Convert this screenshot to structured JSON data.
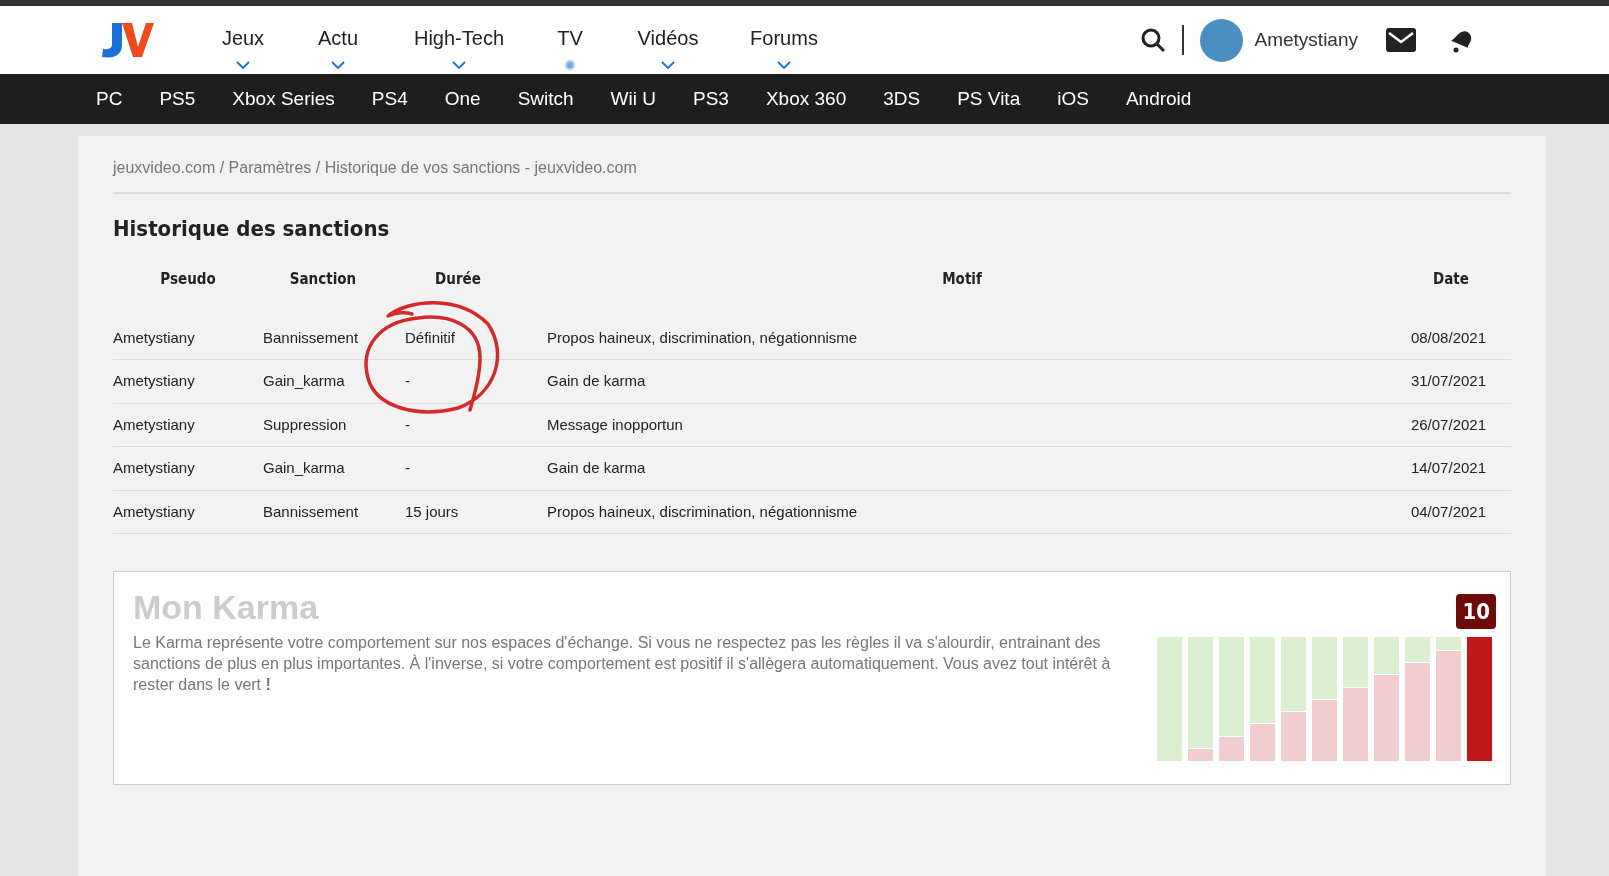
{
  "header": {
    "menu": [
      {
        "label": "Jeux",
        "selected": false
      },
      {
        "label": "Actu",
        "selected": false
      },
      {
        "label": "High-Tech",
        "selected": false
      },
      {
        "label": "TV",
        "selected": true
      },
      {
        "label": "Vidéos",
        "selected": false
      },
      {
        "label": "Forums",
        "selected": false
      }
    ],
    "username": "Ametystiany"
  },
  "platforms": [
    "PC",
    "PS5",
    "Xbox Series",
    "PS4",
    "One",
    "Switch",
    "Wii U",
    "PS3",
    "Xbox 360",
    "3DS",
    "PS Vita",
    "iOS",
    "Android"
  ],
  "breadcrumb": "jeuxvideo.com / Paramètres / Historique de vos sanctions - jeuxvideo.com",
  "title": "Historique des sanctions",
  "table": {
    "columns": [
      "Pseudo",
      "Sanction",
      "Durée",
      "Motif",
      "Date"
    ],
    "rows": [
      [
        "Ametystiany",
        "Bannissement",
        "Définitif",
        "Propos haineux, discrimination, négationnisme",
        "08/08/2021"
      ],
      [
        "Ametystiany",
        "Gain_karma",
        "-",
        "Gain de karma",
        "31/07/2021"
      ],
      [
        "Ametystiany",
        "Suppression",
        "-",
        "Message inopportun",
        "26/07/2021"
      ],
      [
        "Ametystiany",
        "Gain_karma",
        "-",
        "Gain de karma",
        "14/07/2021"
      ],
      [
        "Ametystiany",
        "Bannissement",
        "15 jours",
        "Propos haineux, discrimination, négationnisme",
        "04/07/2021"
      ]
    ]
  },
  "karma": {
    "title": "Mon Karma",
    "text": "Le Karma représente votre comportement sur nos espaces d'échange. Si vous ne respectez pas les règles il va s'alourdir, entrainant des sanctions de plus en plus importantes. À l'inverse, si votre comportement est positif il s'allègera automatiquement. Vous avez tout intérêt à rester dans le vert **!**",
    "score": "10",
    "bars": [
      {
        "selected": false
      },
      {
        "selected": false
      },
      {
        "selected": false
      },
      {
        "selected": false
      },
      {
        "selected": false
      },
      {
        "selected": false
      },
      {
        "selected": false
      },
      {
        "selected": false
      },
      {
        "selected": false
      },
      {
        "selected": false
      },
      {
        "selected": true
      }
    ]
  }
}
